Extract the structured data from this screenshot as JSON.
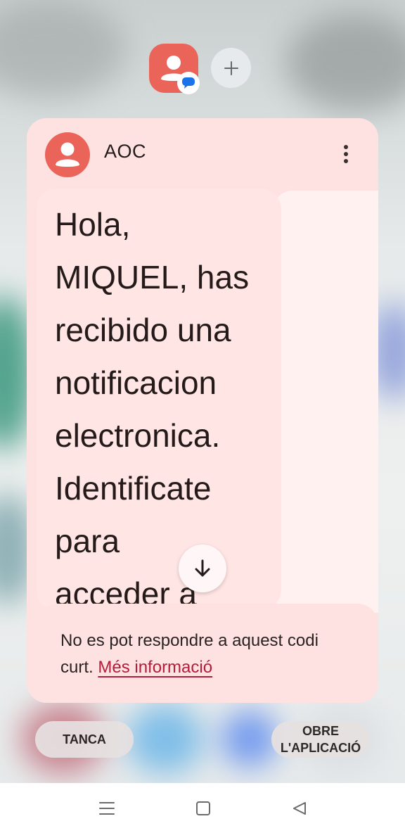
{
  "bubble": {
    "head_icon": "person-icon",
    "badge_icon": "message-icon",
    "add_icon": "plus-icon",
    "head_color": "#ea6459",
    "badge_color": "#1a73e8"
  },
  "card": {
    "background": "#fde2e1",
    "sender": "AOC",
    "avatar_icon": "person-icon",
    "menu_icon": "more-vert-icon",
    "message": "Hola,\nMIQUEL, has\nrecibido una\nnotificacion\nelectronica.\nIdentificate\npara\nacceder a",
    "scroll_icon": "arrow-down-icon",
    "footer_text": "No es pot respondre a aquest codi curt.",
    "footer_link": "Més informació",
    "link_color": "#b21d3a"
  },
  "actions": {
    "close_label": "TANCA",
    "open_label": "OBRE L'APLICACIÓ"
  },
  "navbar": {
    "recents_icon": "menu-lines-icon",
    "home_icon": "square-home-icon",
    "back_icon": "triangle-back-icon"
  }
}
